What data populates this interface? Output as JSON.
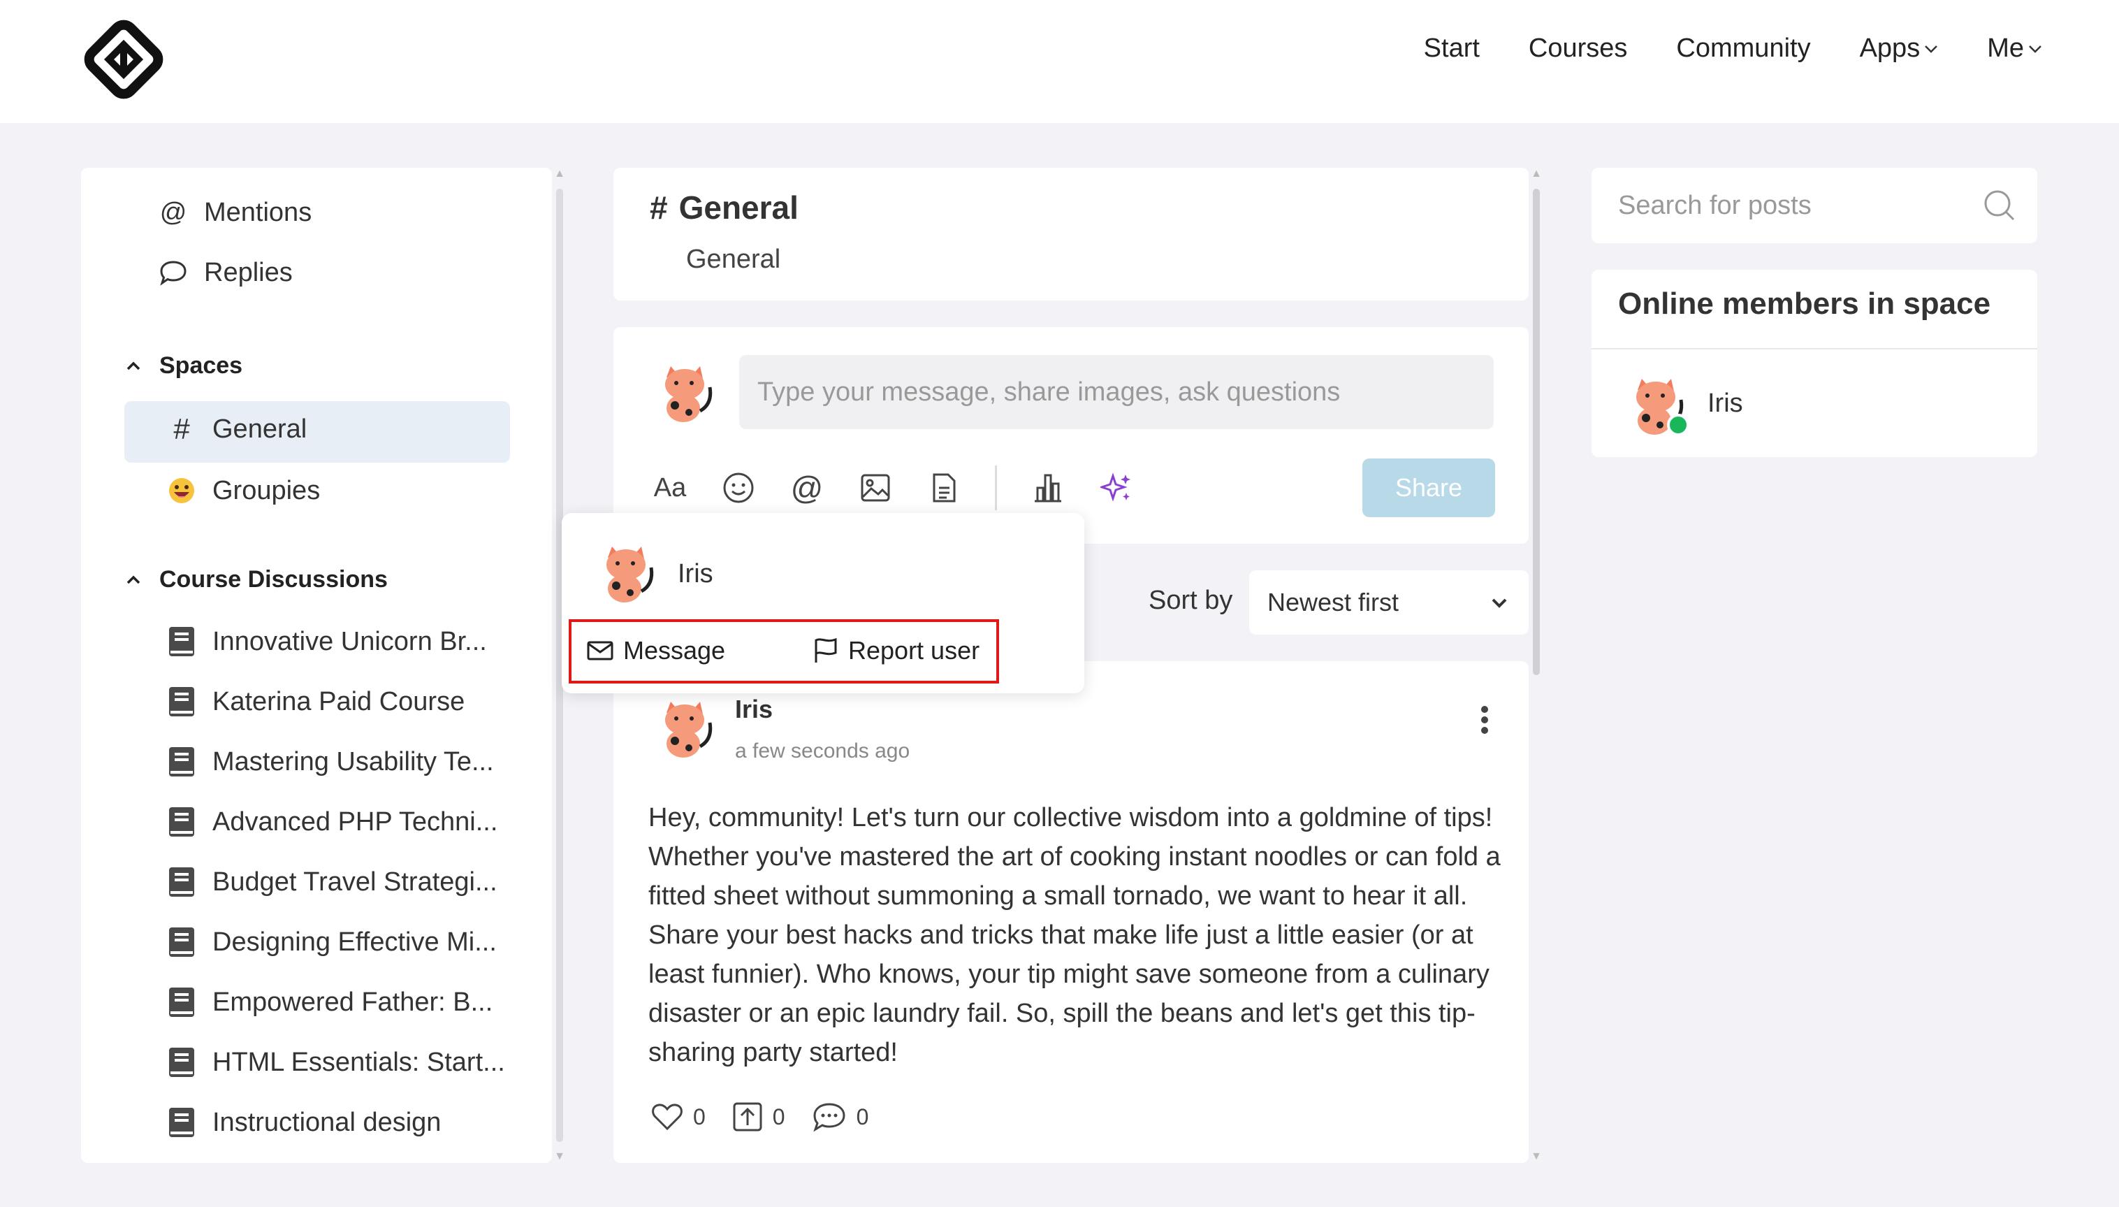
{
  "nav": {
    "items": [
      "Start",
      "Courses",
      "Community",
      "Apps",
      "Me"
    ],
    "chevron": "⌄"
  },
  "sidebar": {
    "quick": [
      {
        "icon": "at-icon",
        "label": "Mentions"
      },
      {
        "icon": "speech-bubble-icon",
        "label": "Replies"
      }
    ],
    "spaces_title": "Spaces",
    "spaces": [
      {
        "icon": "hash-icon",
        "label": "General"
      },
      {
        "icon": "grinning-emoji-icon",
        "label": "Groupies"
      }
    ],
    "courses_title": "Course Discussions",
    "courses": [
      "Innovative Unicorn Br...",
      "Katerina Paid Course",
      "Mastering Usability Te...",
      "Advanced PHP Techni...",
      "Budget Travel Strategi...",
      "Designing Effective Mi...",
      "Empowered Father: B...",
      "HTML Essentials: Start...",
      "Instructional design"
    ]
  },
  "space": {
    "hash": "#",
    "title": "General",
    "subtitle": "General"
  },
  "composer": {
    "placeholder": "Type your message, share images, ask questions",
    "text_tool": "Aa",
    "share_label": "Share"
  },
  "popup": {
    "name": "Iris",
    "message_label": "Message",
    "report_label": "Report user"
  },
  "sort": {
    "label": "Sort by",
    "value": "Newest first"
  },
  "post": {
    "author": "Iris",
    "time": "a few seconds ago",
    "body": "Hey, community! Let's turn our collective wisdom into a goldmine of tips! Whether you've mastered the art of cooking instant noodles or can fold a fitted sheet without summoning a small tornado, we want to hear it all. Share your best hacks and tricks that make life just a little easier (or at least funnier). Who knows, your tip might save someone from a culinary disaster or an epic laundry fail. So, spill the beans and let's get this tip-sharing party started!",
    "likes": "0",
    "shares": "0",
    "comments": "0"
  },
  "search": {
    "placeholder": "Search for posts"
  },
  "online": {
    "title": "Online members in space",
    "members": [
      "Iris"
    ]
  },
  "colors": {
    "accent_light": "#b7d9e8",
    "active_bg": "#e8eef5",
    "online": "#18b75a",
    "highlight": "#e01818",
    "ai_icon": "#8a3fd1"
  }
}
